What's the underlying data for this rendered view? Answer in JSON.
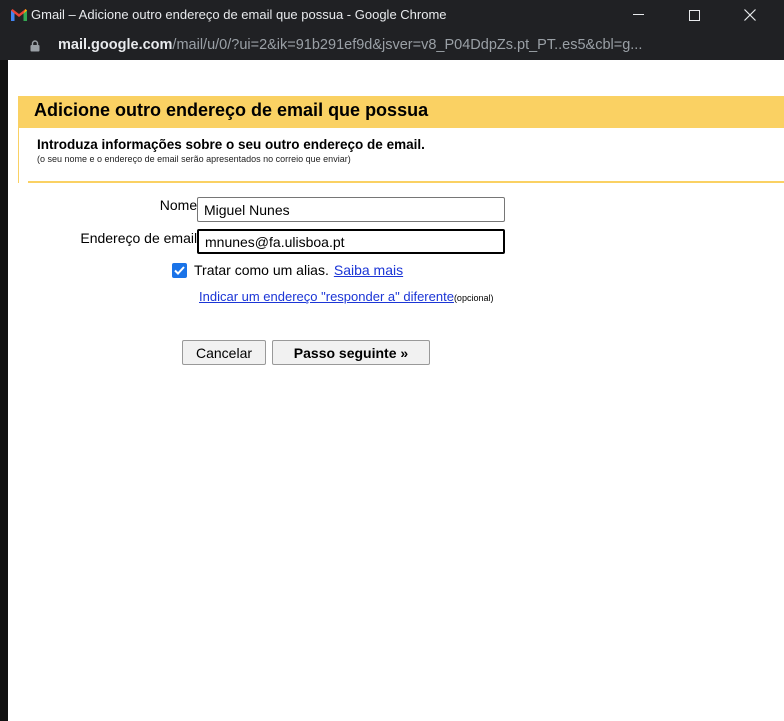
{
  "window": {
    "title": "Gmail – Adicione outro endereço de email que possua - Google Chrome",
    "url_host": "mail.google.com",
    "url_path": "/mail/u/0/?ui=2&ik=91b291ef9d&jsver=v8_P04DdpZs.pt_PT..es5&cbl=g..."
  },
  "page": {
    "title": "Adicione outro endereço de email que possua",
    "subtitle": "Introduza informações sobre o seu outro endereço de email.",
    "hint": "(o seu nome e o endereço de email serão apresentados no correio que enviar)"
  },
  "form": {
    "name_label": "Nome:",
    "name_value": "Miguel Nunes",
    "email_label": "Endereço de email:",
    "email_value": "mnunes@fa.ulisboa.pt",
    "alias_checked": true,
    "alias_label": "Tratar como um alias.",
    "alias_link": "Saiba mais",
    "reply_link": "Indicar um endereço \"responder a\" diferente",
    "reply_optional": "(opcional)"
  },
  "buttons": {
    "cancel": "Cancelar",
    "next": "Passo seguinte »"
  },
  "colors": {
    "header_bar": "#fad163",
    "titlebar": "#202124",
    "link": "#1b35d6",
    "checkbox": "#1a73e8"
  }
}
